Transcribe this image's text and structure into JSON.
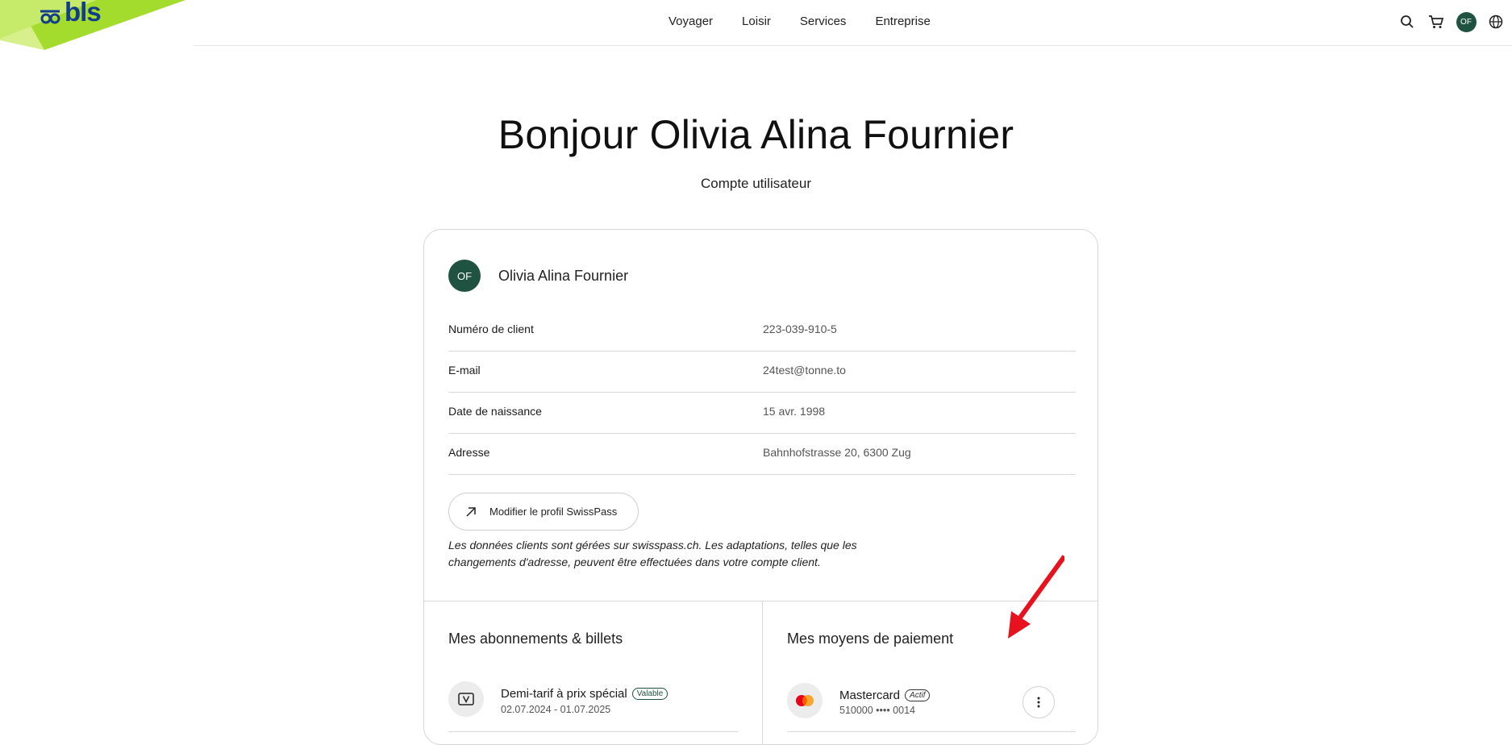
{
  "header": {
    "logo": "bls",
    "nav": [
      "Voyager",
      "Loisir",
      "Services",
      "Entreprise"
    ],
    "avatar_initials": "OF",
    "icons": [
      "search-icon",
      "cart-icon",
      "avatar",
      "globe-icon"
    ]
  },
  "hero": {
    "title": "Bonjour Olivia Alina Fournier",
    "subtitle": "Compte utilisateur"
  },
  "profile": {
    "initials": "OF",
    "name": "Olivia Alina Fournier",
    "rows": [
      {
        "label": "Numéro de client",
        "value": "223-039-910-5"
      },
      {
        "label": "E-mail",
        "value": "24test@tonne.to"
      },
      {
        "label": "Date de naissance",
        "value": "15 avr. 1998"
      },
      {
        "label": "Adresse",
        "value": "Bahnhofstrasse 20,  6300 Zug"
      }
    ],
    "edit_button": "Modifier le profil SwissPass",
    "note": "Les données clients sont gérées sur swisspass.ch. Les adaptations, telles que les changements d'adresse, peuvent être effectuées dans votre compte client."
  },
  "subscriptions": {
    "title": "Mes abonnements & billets",
    "items": [
      {
        "name": "Demi-tarif à prix spécial",
        "badge": "Valable",
        "dates": "02.07.2024 - 01.07.2025",
        "icon": "ticket-icon"
      }
    ]
  },
  "payments": {
    "title": "Mes moyens de paiement",
    "items": [
      {
        "name": "Mastercard",
        "badge": "Actif",
        "number": "510000 •••• 0014",
        "icon": "mastercard-icon"
      }
    ]
  },
  "colors": {
    "brand_green": "#1f5240",
    "logo_blue": "#123c8c",
    "logo_lime": "#8dd21c",
    "annotation_red": "#e8121e"
  }
}
